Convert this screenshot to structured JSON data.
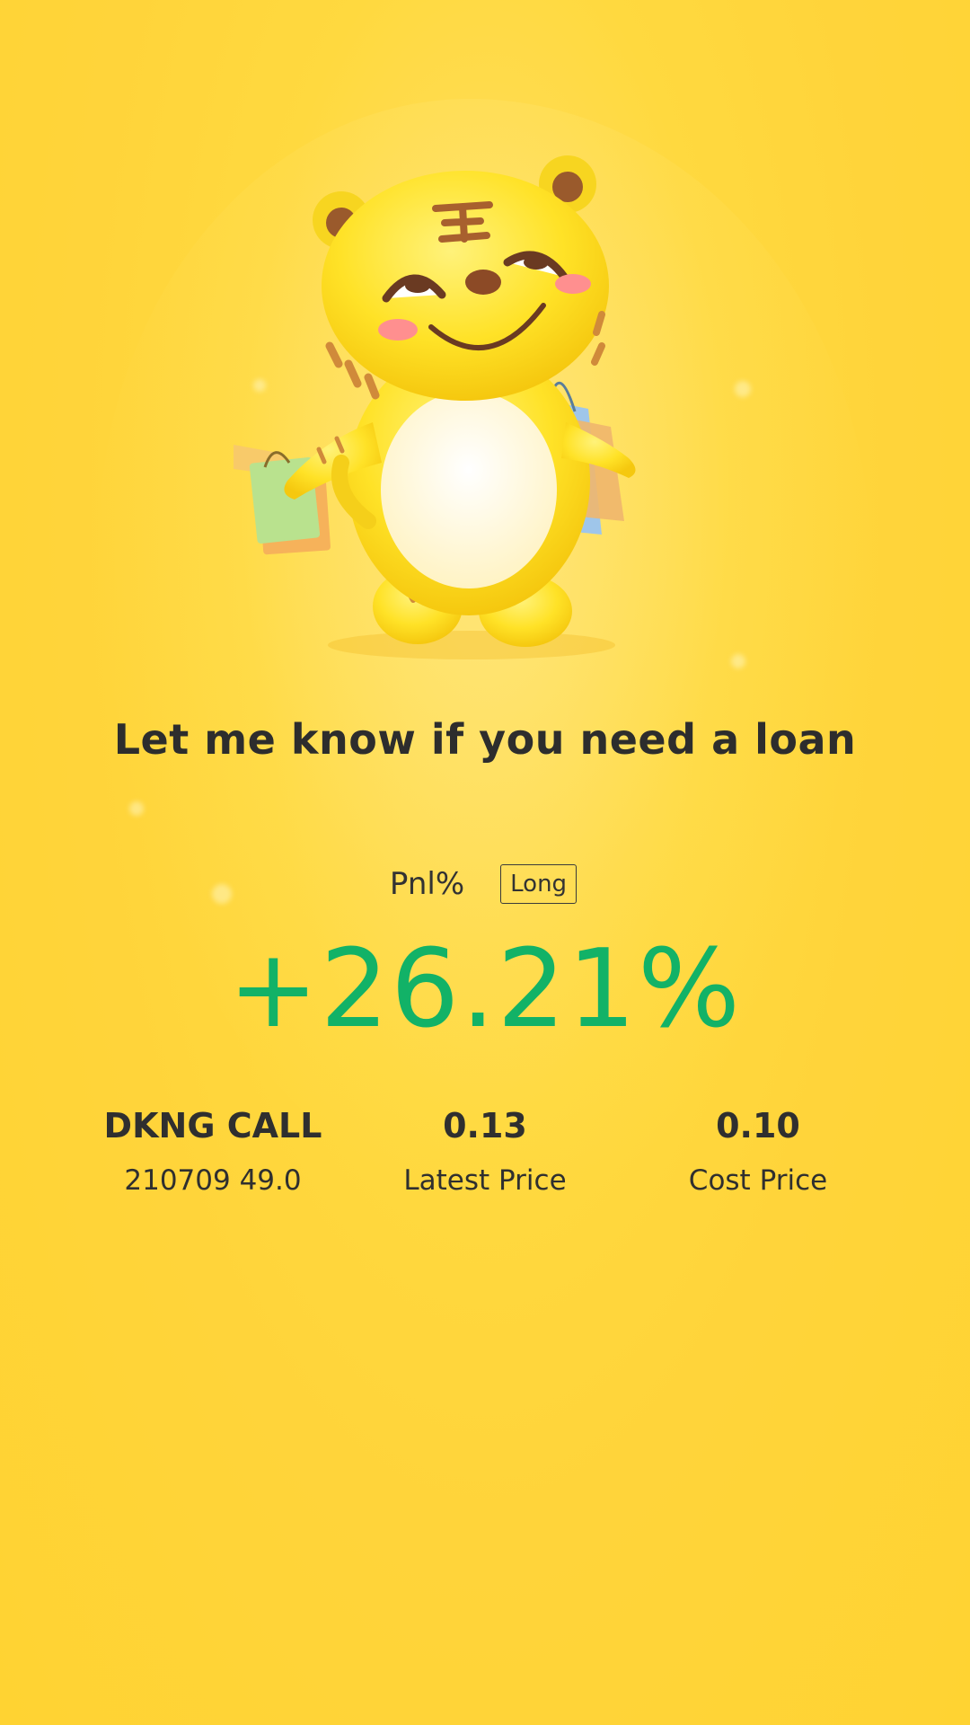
{
  "headline": "Let me know if you need a loan",
  "pnl": {
    "label": "Pnl%",
    "position_badge": "Long",
    "value": "+26.21%",
    "value_color": "#12b267"
  },
  "stats": {
    "symbol": "DKNG CALL",
    "contract": "210709 49.0",
    "latest_price": "0.13",
    "latest_price_label": "Latest Price",
    "cost_price": "0.10",
    "cost_price_label": "Cost Price"
  },
  "mascot": {
    "icon": "tiger-mascot-with-shopping-bags"
  },
  "colors": {
    "background": "#ffd43a",
    "text": "#2d2d2d",
    "gain": "#12b267"
  }
}
